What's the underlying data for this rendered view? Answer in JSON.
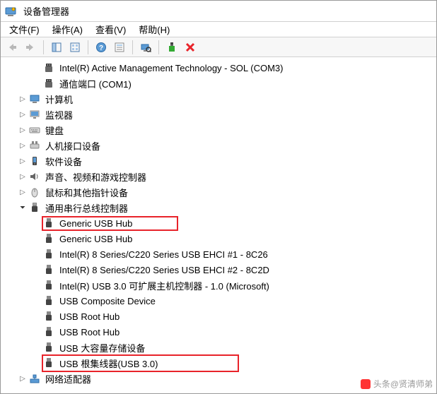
{
  "window": {
    "title": "设备管理器"
  },
  "menu": {
    "file": "文件(F)",
    "action": "操作(A)",
    "view": "查看(V)",
    "help": "帮助(H)"
  },
  "tree": {
    "ports": {
      "items": [
        "Intel(R) Active Management Technology - SOL (COM3)",
        "通信端口 (COM1)"
      ]
    },
    "categories": [
      {
        "label": "计算机",
        "icon": "computer"
      },
      {
        "label": "监视器",
        "icon": "monitor"
      },
      {
        "label": "键盘",
        "icon": "keyboard"
      },
      {
        "label": "人机接口设备",
        "icon": "hid"
      },
      {
        "label": "软件设备",
        "icon": "software"
      },
      {
        "label": "声音、视频和游戏控制器",
        "icon": "sound"
      },
      {
        "label": "鼠标和其他指针设备",
        "icon": "mouse"
      },
      {
        "label": "通用串行总线控制器",
        "icon": "usb",
        "expanded": true
      }
    ],
    "usb_items": [
      {
        "label": "Generic USB Hub",
        "highlight": true
      },
      {
        "label": "Generic USB Hub"
      },
      {
        "label": "Intel(R) 8 Series/C220 Series USB EHCI #1 - 8C26"
      },
      {
        "label": "Intel(R) 8 Series/C220 Series USB EHCI #2 - 8C2D"
      },
      {
        "label": "Intel(R) USB 3.0 可扩展主机控制器 - 1.0 (Microsoft)"
      },
      {
        "label": "USB Composite Device"
      },
      {
        "label": "USB Root Hub"
      },
      {
        "label": "USB Root Hub"
      },
      {
        "label": "USB 大容量存储设备"
      },
      {
        "label": "USB 根集线器(USB 3.0)",
        "highlight": true
      }
    ],
    "network": {
      "label": "网络适配器"
    }
  },
  "watermark": {
    "text": "头条@贤清师弟"
  }
}
